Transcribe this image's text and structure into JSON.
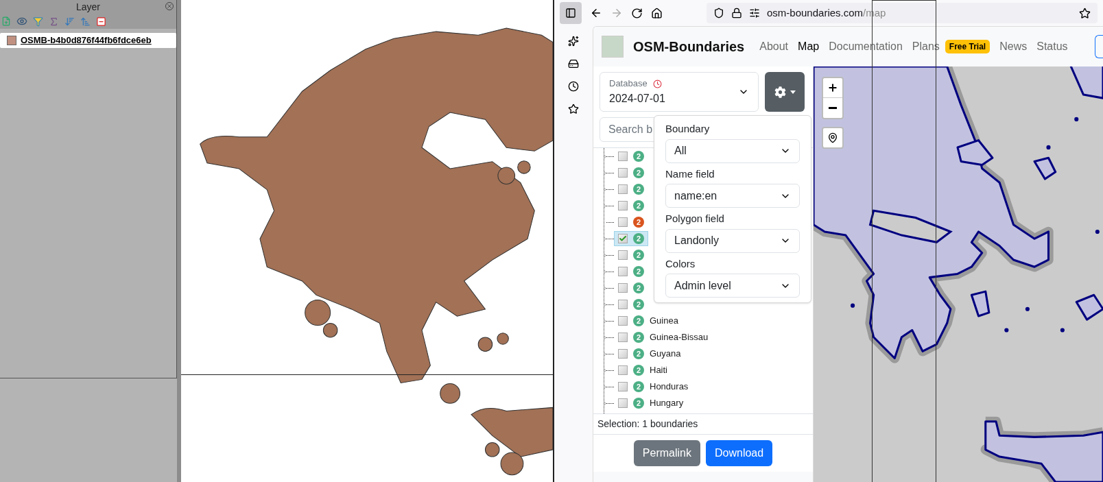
{
  "layer_panel": {
    "title": "Layer",
    "layers": [
      {
        "name": "OSMB-b4b0d876f44fb6fdce6eb",
        "visible": true
      }
    ]
  },
  "browser": {
    "url_host": "osm-boundaries.com",
    "url_path": "/map"
  },
  "site": {
    "brand": "OSM-Boundaries",
    "nav": [
      {
        "label": "About",
        "selected": false
      },
      {
        "label": "Map",
        "selected": true
      },
      {
        "label": "Documentation",
        "selected": false
      },
      {
        "label": "Plans",
        "selected": false,
        "badge": "Free Trial"
      },
      {
        "label": "News",
        "selected": false
      },
      {
        "label": "Status",
        "selected": false
      }
    ]
  },
  "database": {
    "label": "Database",
    "value": "2024-07-01"
  },
  "search": {
    "placeholder": "Search b"
  },
  "settings_menu": {
    "fields": [
      {
        "label": "Boundary",
        "value": "All"
      },
      {
        "label": "Name field",
        "value": "name:en"
      },
      {
        "label": "Polygon field",
        "value": "Landonly"
      },
      {
        "label": "Colors",
        "value": "Admin level"
      }
    ]
  },
  "boundaries": [
    {
      "checked": false,
      "selected": false,
      "expandable": true,
      "level": "2",
      "color": "#4caf85"
    },
    {
      "checked": false,
      "selected": false,
      "expandable": true,
      "level": "2",
      "color": "#4caf85"
    },
    {
      "checked": false,
      "selected": false,
      "expandable": true,
      "level": "2",
      "color": "#4caf85"
    },
    {
      "checked": false,
      "selected": false,
      "expandable": true,
      "level": "2",
      "color": "#4caf85"
    },
    {
      "checked": false,
      "selected": false,
      "expandable": false,
      "level": "2",
      "color": "#d9541e"
    },
    {
      "checked": true,
      "selected": true,
      "expandable": true,
      "level": "2",
      "color": "#4caf85"
    },
    {
      "checked": false,
      "selected": false,
      "expandable": true,
      "level": "2",
      "color": "#4caf85"
    },
    {
      "checked": false,
      "selected": false,
      "expandable": true,
      "level": "2",
      "color": "#4caf85"
    },
    {
      "checked": false,
      "selected": false,
      "expandable": true,
      "level": "2",
      "color": "#4caf85"
    },
    {
      "checked": false,
      "selected": false,
      "expandable": true,
      "level": "2",
      "color": "#4caf85"
    },
    {
      "label": "Guinea",
      "checked": false,
      "selected": false,
      "expandable": true,
      "level": "2",
      "color": "#4caf85"
    },
    {
      "label": "Guinea-Bissau",
      "checked": false,
      "selected": false,
      "expandable": true,
      "level": "2",
      "color": "#4caf85"
    },
    {
      "label": "Guyana",
      "checked": false,
      "selected": false,
      "expandable": true,
      "level": "2",
      "color": "#4caf85"
    },
    {
      "label": "Haiti",
      "checked": false,
      "selected": false,
      "expandable": true,
      "level": "2",
      "color": "#4caf85"
    },
    {
      "label": "Honduras",
      "checked": false,
      "selected": false,
      "expandable": true,
      "level": "2",
      "color": "#4caf85"
    },
    {
      "label": "Hungary",
      "checked": false,
      "selected": false,
      "expandable": true,
      "level": "2",
      "color": "#4caf85"
    }
  ],
  "selection": "Selection: 1 boundaries",
  "buttons": [
    {
      "label": "Permalink",
      "kind": "secondary"
    },
    {
      "label": "Download",
      "kind": "primary"
    }
  ]
}
